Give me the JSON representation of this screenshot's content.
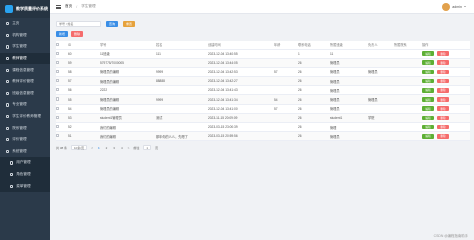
{
  "app": {
    "title": "教学质量评价系统"
  },
  "sidebar": {
    "items": [
      {
        "label": "主页"
      },
      {
        "label": "机构管理"
      },
      {
        "label": "学生管理"
      },
      {
        "label": "教师管理"
      },
      {
        "label": "课程信息管理"
      },
      {
        "label": "教师评价管理"
      },
      {
        "label": "班级信息管理"
      },
      {
        "label": "专业管理"
      },
      {
        "label": "学生评价教师管理"
      },
      {
        "label": "院系管理"
      },
      {
        "label": "评价管理"
      },
      {
        "label": "系统管理"
      },
      {
        "label": "用户管理"
      },
      {
        "label": "角色管理"
      },
      {
        "label": "菜单管理"
      }
    ]
  },
  "header": {
    "breadcrumb": [
      "首页",
      "学生管理"
    ],
    "user": "admin"
  },
  "search": {
    "placeholder": "学号 / 姓名",
    "query_label": "查询",
    "reset_label": "重置"
  },
  "actions": {
    "add_label": "新增",
    "delete_label": "删除"
  },
  "table": {
    "columns": [
      "",
      "ID",
      "学号",
      "姓名",
      "创建时间",
      "年龄",
      "联系电话",
      "所属班级",
      "负责人",
      "所属院系",
      "操作"
    ],
    "rows": [
      {
        "id": "60",
        "no": "11班级",
        "name": "111",
        "created": "2023-12-04 13:40:55",
        "age": "",
        "phone": "1",
        "class": "11",
        "leader": "",
        "dept": ""
      },
      {
        "id": "59",
        "no": "579775/7000005",
        "name": "",
        "created": "2023-12-04 13:44:05",
        "age": "",
        "phone": "26",
        "class": "管理员",
        "leader": "",
        "dept": ""
      },
      {
        "id": "58",
        "no": "管理员的编辑",
        "name": "9999",
        "created": "2023-12-04 13:42:53",
        "age": "57",
        "phone": "26",
        "class": "管理员",
        "leader": "管理员",
        "dept": ""
      },
      {
        "id": "57",
        "no": "管理员的编辑",
        "name": "88888",
        "created": "2023-12-04 13:42:27",
        "age": "",
        "phone": "26",
        "class": "管理员",
        "leader": "",
        "dept": ""
      },
      {
        "id": "56",
        "no": "2222",
        "name": "",
        "created": "2023-12-04 13:41:43",
        "age": "",
        "phone": "26",
        "class": "管理员",
        "leader": "",
        "dept": ""
      },
      {
        "id": "55",
        "no": "管理员的编辑",
        "name": "9999",
        "created": "2023-12-04 13:41:34",
        "age": "54",
        "phone": "26",
        "class": "管理员",
        "leader": "管理员",
        "dept": ""
      },
      {
        "id": "54",
        "no": "管理员的编辑",
        "name": "",
        "created": "2023-12-04 13:41:00",
        "age": "57",
        "phone": "26",
        "class": "管理员",
        "leader": "",
        "dept": ""
      },
      {
        "id": "53",
        "no": "student1管理员",
        "name": "测试",
        "created": "2023-11-15 20:09:09",
        "age": "",
        "phone": "26",
        "class": "student1",
        "leader": "学院",
        "dept": ""
      },
      {
        "id": "52",
        "no": "我们的编辑",
        "name": "",
        "created": "2023-03-15 23:00:39",
        "age": "",
        "phone": "26",
        "class": "管理",
        "leader": "",
        "dept": ""
      },
      {
        "id": "51",
        "no": "我们的编辑",
        "name": "那年你的么么，先嗯了",
        "created": "2023-03-15 20:59:56",
        "age": "",
        "phone": "26",
        "class": "管理员",
        "leader": "",
        "dept": ""
      }
    ],
    "edit_label": "编辑",
    "delete_label": "删除"
  },
  "pagination": {
    "total_text": "共 38 条",
    "size_text": "10条/页",
    "prev": "<",
    "pages": [
      "1",
      "2",
      "3",
      "4"
    ],
    "next": ">",
    "goto_text": "前往",
    "goto_value": "1",
    "page_unit": "页"
  },
  "watermark": "CSDN @编程指南助手",
  "colors": {
    "primary": "#3a8ee6",
    "success": "#5daf34",
    "danger": "#f56c6c",
    "warning": "#e6a23c",
    "sidebar": "#2b3a4a"
  }
}
